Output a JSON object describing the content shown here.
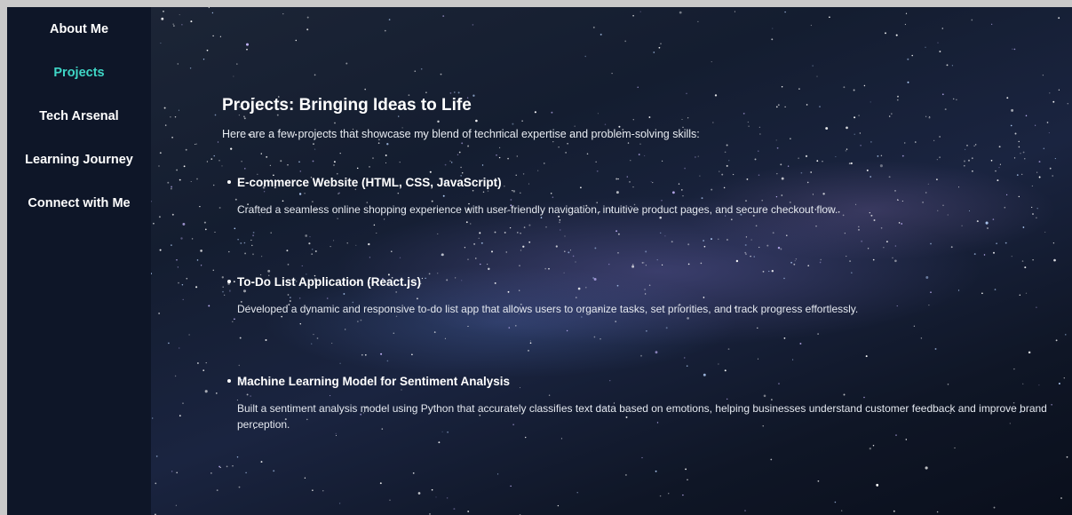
{
  "sidebar": {
    "items": [
      {
        "label": "About Me",
        "active": false
      },
      {
        "label": "Projects",
        "active": true
      },
      {
        "label": "Tech Arsenal",
        "active": false
      },
      {
        "label": "Learning Journey",
        "active": false
      },
      {
        "label": "Connect with Me",
        "active": false
      }
    ]
  },
  "main": {
    "title": "Projects: Bringing Ideas to Life",
    "intro": "Here are a few projects that showcase my blend of technical expertise and problem-solving skills:",
    "projects": [
      {
        "title": "E-commerce Website (HTML, CSS, JavaScript)",
        "description": "Crafted a seamless online shopping experience with user-friendly navigation, intuitive product pages, and secure checkout flow."
      },
      {
        "title": "To-Do List Application (React.js)",
        "description": "Developed a dynamic and responsive to-do list app that allows users to organize tasks, set priorities, and track progress effortlessly."
      },
      {
        "title": "Machine Learning Model for Sentiment Analysis",
        "description": "Built a sentiment analysis model using Python that accurately classifies text data based on emotions, helping businesses understand customer feedback and improve brand perception."
      }
    ]
  },
  "colors": {
    "sidebar_bg": "#0e1628",
    "active_nav": "#3fd6c6",
    "text": "#ffffff"
  }
}
